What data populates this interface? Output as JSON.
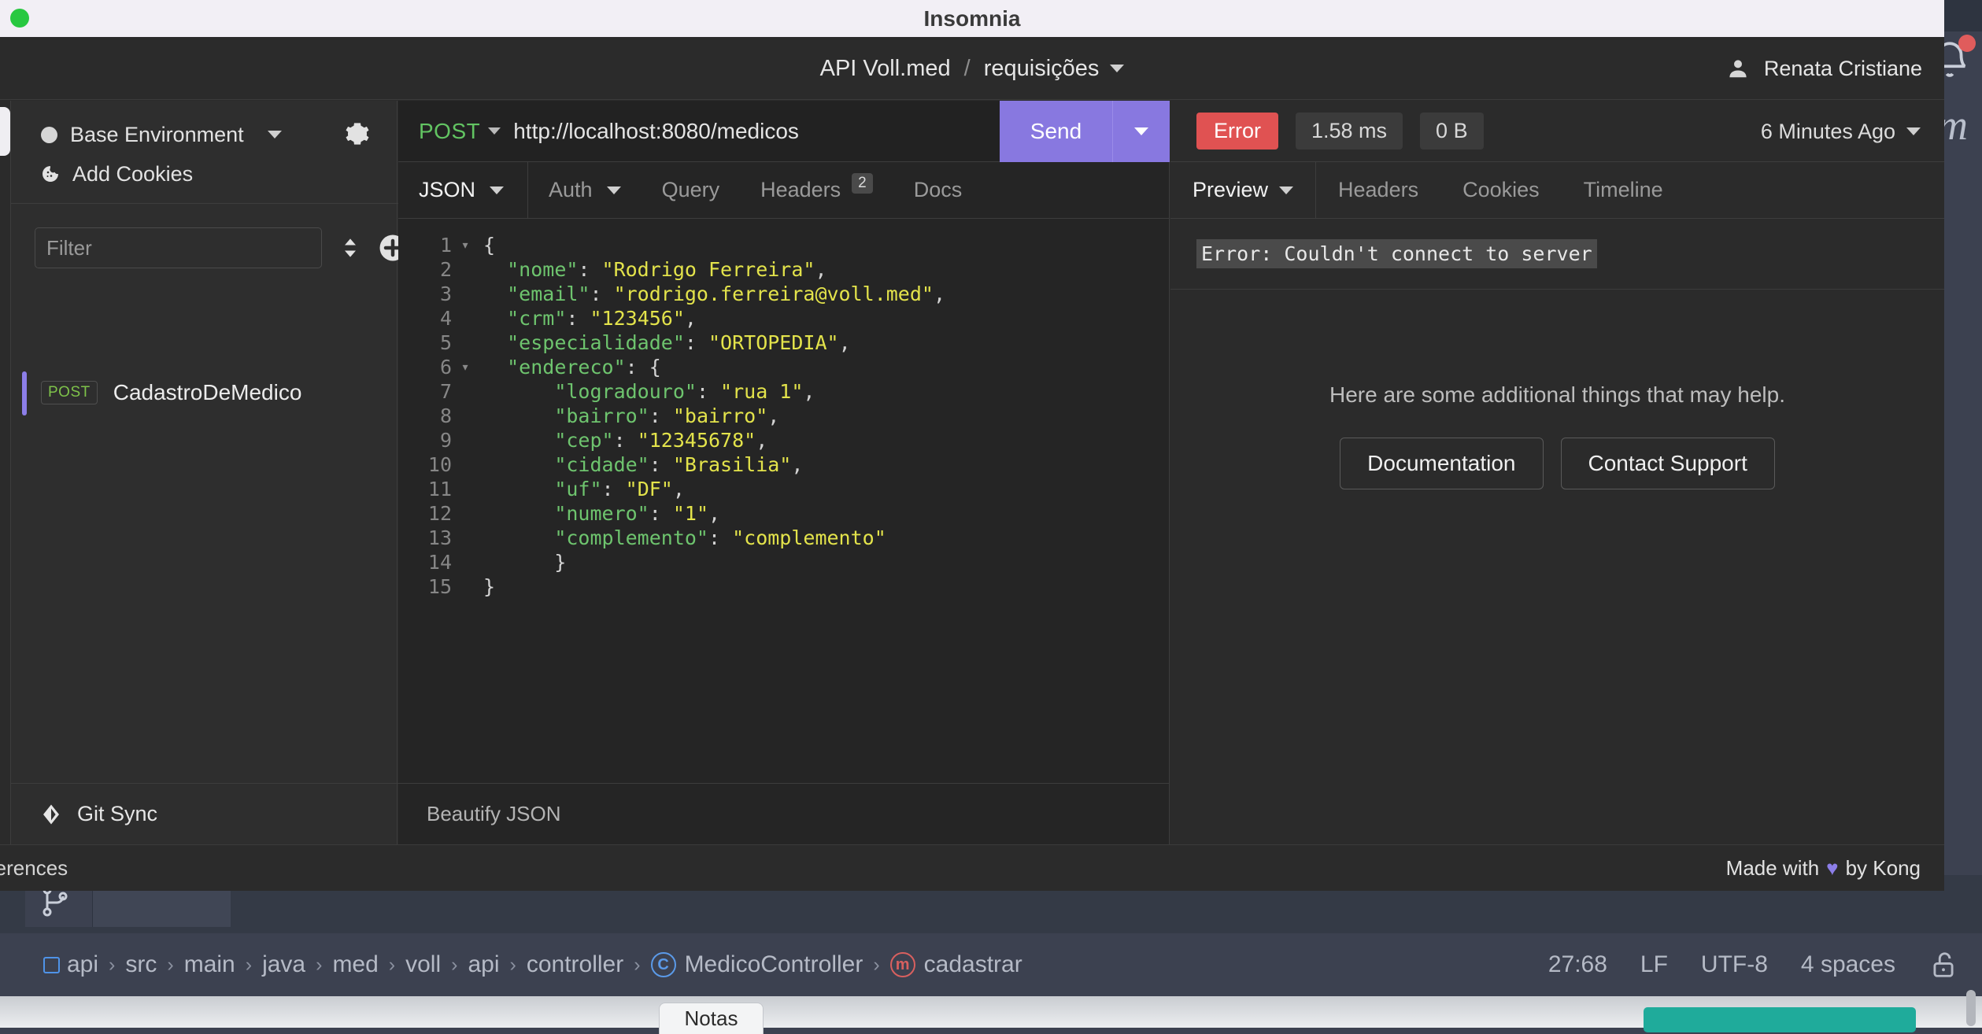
{
  "window": {
    "title": "Insomnia",
    "traffic_light_color": "#28c840"
  },
  "header": {
    "workspace": "API Voll.med",
    "separator": "/",
    "folder": "requisições",
    "user_name": "Renata Cristiane"
  },
  "sidebar": {
    "environment": "Base Environment",
    "cookies_label": "Add Cookies",
    "filter_placeholder": "Filter",
    "filter_value": "",
    "requests": [
      {
        "method": "POST",
        "name": "CadastroDeMedico",
        "active": true
      }
    ],
    "git_sync_label": "Git Sync"
  },
  "request": {
    "method": "POST",
    "url": "http://localhost:8080/medicos",
    "send_label": "Send",
    "tabs": [
      {
        "label": "JSON",
        "active": true,
        "has_caret": true,
        "badge": null
      },
      {
        "label": "Auth",
        "active": false,
        "has_caret": true,
        "badge": null
      },
      {
        "label": "Query",
        "active": false,
        "has_caret": false,
        "badge": null
      },
      {
        "label": "Headers",
        "active": false,
        "has_caret": false,
        "badge": "2"
      },
      {
        "label": "Docs",
        "active": false,
        "has_caret": false,
        "badge": null
      }
    ],
    "beautify_label": "Beautify JSON",
    "body_lines": [
      {
        "num": "1",
        "fold": true,
        "segments": [
          {
            "t": "{",
            "c": "p"
          }
        ]
      },
      {
        "num": "2",
        "fold": false,
        "segments": [
          {
            "t": "  ",
            "c": "p"
          },
          {
            "t": "\"nome\"",
            "c": "k"
          },
          {
            "t": ": ",
            "c": "p"
          },
          {
            "t": "\"Rodrigo Ferreira\"",
            "c": "v"
          },
          {
            "t": ",",
            "c": "p"
          }
        ]
      },
      {
        "num": "3",
        "fold": false,
        "segments": [
          {
            "t": "  ",
            "c": "p"
          },
          {
            "t": "\"email\"",
            "c": "k"
          },
          {
            "t": ": ",
            "c": "p"
          },
          {
            "t": "\"rodrigo.ferreira@voll.med\"",
            "c": "v"
          },
          {
            "t": ",",
            "c": "p"
          }
        ]
      },
      {
        "num": "4",
        "fold": false,
        "segments": [
          {
            "t": "  ",
            "c": "p"
          },
          {
            "t": "\"crm\"",
            "c": "k"
          },
          {
            "t": ": ",
            "c": "p"
          },
          {
            "t": "\"123456\"",
            "c": "v"
          },
          {
            "t": ",",
            "c": "p"
          }
        ]
      },
      {
        "num": "5",
        "fold": false,
        "segments": [
          {
            "t": "  ",
            "c": "p"
          },
          {
            "t": "\"especialidade\"",
            "c": "k"
          },
          {
            "t": ": ",
            "c": "p"
          },
          {
            "t": "\"ORTOPEDIA\"",
            "c": "v"
          },
          {
            "t": ",",
            "c": "p"
          }
        ]
      },
      {
        "num": "6",
        "fold": true,
        "segments": [
          {
            "t": "  ",
            "c": "p"
          },
          {
            "t": "\"endereco\"",
            "c": "k"
          },
          {
            "t": ": ",
            "c": "p"
          },
          {
            "t": "{",
            "c": "p"
          }
        ]
      },
      {
        "num": "7",
        "fold": false,
        "segments": [
          {
            "t": "      ",
            "c": "p"
          },
          {
            "t": "\"logradouro\"",
            "c": "k"
          },
          {
            "t": ": ",
            "c": "p"
          },
          {
            "t": "\"rua 1\"",
            "c": "v"
          },
          {
            "t": ",",
            "c": "p"
          }
        ]
      },
      {
        "num": "8",
        "fold": false,
        "segments": [
          {
            "t": "      ",
            "c": "p"
          },
          {
            "t": "\"bairro\"",
            "c": "k"
          },
          {
            "t": ": ",
            "c": "p"
          },
          {
            "t": "\"bairro\"",
            "c": "v"
          },
          {
            "t": ",",
            "c": "p"
          }
        ]
      },
      {
        "num": "9",
        "fold": false,
        "segments": [
          {
            "t": "      ",
            "c": "p"
          },
          {
            "t": "\"cep\"",
            "c": "k"
          },
          {
            "t": ": ",
            "c": "p"
          },
          {
            "t": "\"12345678\"",
            "c": "v"
          },
          {
            "t": ",",
            "c": "p"
          }
        ]
      },
      {
        "num": "10",
        "fold": false,
        "segments": [
          {
            "t": "      ",
            "c": "p"
          },
          {
            "t": "\"cidade\"",
            "c": "k"
          },
          {
            "t": ": ",
            "c": "p"
          },
          {
            "t": "\"Brasilia\"",
            "c": "v"
          },
          {
            "t": ",",
            "c": "p"
          }
        ]
      },
      {
        "num": "11",
        "fold": false,
        "segments": [
          {
            "t": "      ",
            "c": "p"
          },
          {
            "t": "\"uf\"",
            "c": "k"
          },
          {
            "t": ": ",
            "c": "p"
          },
          {
            "t": "\"DF\"",
            "c": "v"
          },
          {
            "t": ",",
            "c": "p"
          }
        ]
      },
      {
        "num": "12",
        "fold": false,
        "segments": [
          {
            "t": "      ",
            "c": "p"
          },
          {
            "t": "\"numero\"",
            "c": "k"
          },
          {
            "t": ": ",
            "c": "p"
          },
          {
            "t": "\"1\"",
            "c": "v"
          },
          {
            "t": ",",
            "c": "p"
          }
        ]
      },
      {
        "num": "13",
        "fold": false,
        "segments": [
          {
            "t": "      ",
            "c": "p"
          },
          {
            "t": "\"complemento\"",
            "c": "k"
          },
          {
            "t": ": ",
            "c": "p"
          },
          {
            "t": "\"complemento\"",
            "c": "v"
          }
        ]
      },
      {
        "num": "14",
        "fold": false,
        "segments": [
          {
            "t": "      }",
            "c": "p"
          }
        ]
      },
      {
        "num": "15",
        "fold": false,
        "segments": [
          {
            "t": "}",
            "c": "p"
          }
        ]
      }
    ]
  },
  "response": {
    "status": "Error",
    "status_color": "#e05252",
    "time": "1.58 ms",
    "size": "0 B",
    "age": "6 Minutes Ago",
    "tabs": [
      {
        "label": "Preview",
        "active": true,
        "has_caret": true
      },
      {
        "label": "Headers",
        "active": false,
        "has_caret": false
      },
      {
        "label": "Cookies",
        "active": false,
        "has_caret": false
      },
      {
        "label": "Timeline",
        "active": false,
        "has_caret": false
      }
    ],
    "error_message": "Error: Couldn't connect to server",
    "help_text": "Here are some additional things that may help.",
    "help_buttons": [
      "Documentation",
      "Contact Support"
    ]
  },
  "footer": {
    "preferences_label": "eferences",
    "made_with_prefix": "Made with",
    "heart": "♥",
    "made_with_suffix": "by Kong",
    "accent_color": "#8c7ee8"
  },
  "ide": {
    "breadcrumb": [
      {
        "label": "api",
        "icon": "module-icon"
      },
      {
        "label": "src",
        "icon": null
      },
      {
        "label": "main",
        "icon": null
      },
      {
        "label": "java",
        "icon": null
      },
      {
        "label": "med",
        "icon": null
      },
      {
        "label": "voll",
        "icon": null
      },
      {
        "label": "api",
        "icon": null
      },
      {
        "label": "controller",
        "icon": null
      },
      {
        "label": "MedicoController",
        "icon": "class-icon",
        "icon_letter": "C"
      },
      {
        "label": "cadastrar",
        "icon": "method-icon",
        "icon_letter": "m"
      }
    ],
    "status": {
      "caret_position": "27:68",
      "line_separator": "LF",
      "encoding": "UTF-8",
      "indent": "4 spaces"
    },
    "bottom_tab": "Notas"
  }
}
